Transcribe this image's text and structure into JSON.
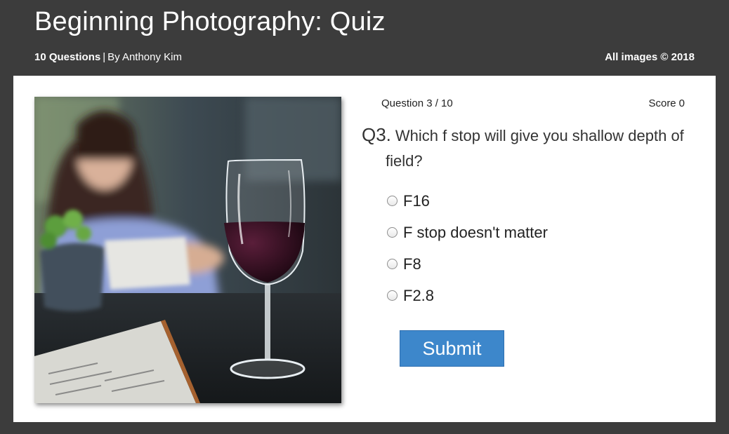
{
  "header": {
    "title": "Beginning Photography: Quiz",
    "question_count": "10 Questions",
    "separator": "|",
    "author": "By Anthony Kim",
    "copyright": "All images © 2018"
  },
  "quiz": {
    "progress": "Question 3 / 10",
    "score_label": "Score",
    "score_value": "0",
    "question_number": "Q3.",
    "question_text": "Which f stop will give you shallow depth of field?",
    "answers": [
      "F16",
      "F stop doesn't matter",
      "F8",
      "F2.8"
    ],
    "submit_label": "Submit"
  },
  "icons": {
    "photo": "wine-glass-photo"
  },
  "colors": {
    "header_background": "#3c3c3c",
    "card_background": "#ffffff",
    "submit_button": "#3d87cb"
  }
}
